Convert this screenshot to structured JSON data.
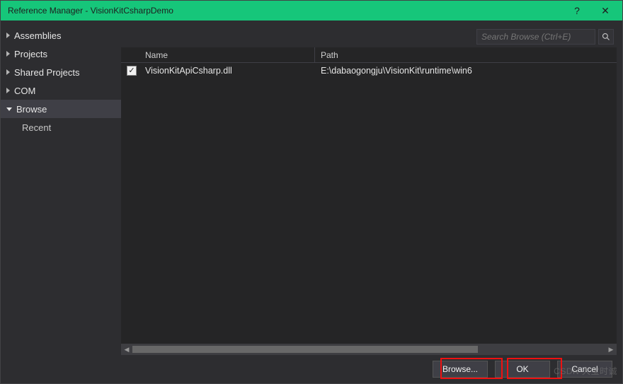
{
  "title": "Reference Manager - VisionKitCsharpDemo",
  "titlebar": {
    "help": "?",
    "close": "✕"
  },
  "sidebar": {
    "items": [
      {
        "label": "Assemblies",
        "expanded": false
      },
      {
        "label": "Projects",
        "expanded": false
      },
      {
        "label": "Shared Projects",
        "expanded": false
      },
      {
        "label": "COM",
        "expanded": false
      },
      {
        "label": "Browse",
        "expanded": true,
        "selected": true
      }
    ],
    "sub": {
      "label": "Recent"
    }
  },
  "search": {
    "placeholder": "Search Browse (Ctrl+E)"
  },
  "columns": {
    "name": "Name",
    "path": "Path"
  },
  "rows": [
    {
      "checked": true,
      "name": "VisionKitApiCsharp.dll",
      "path": "E:\\dabaogongju\\VisionKit\\runtime\\win6"
    }
  ],
  "footer": {
    "browse": "Browse...",
    "ok": "OK",
    "cancel": "Cancel"
  },
  "watermark": "CSDN 大宝时诚"
}
